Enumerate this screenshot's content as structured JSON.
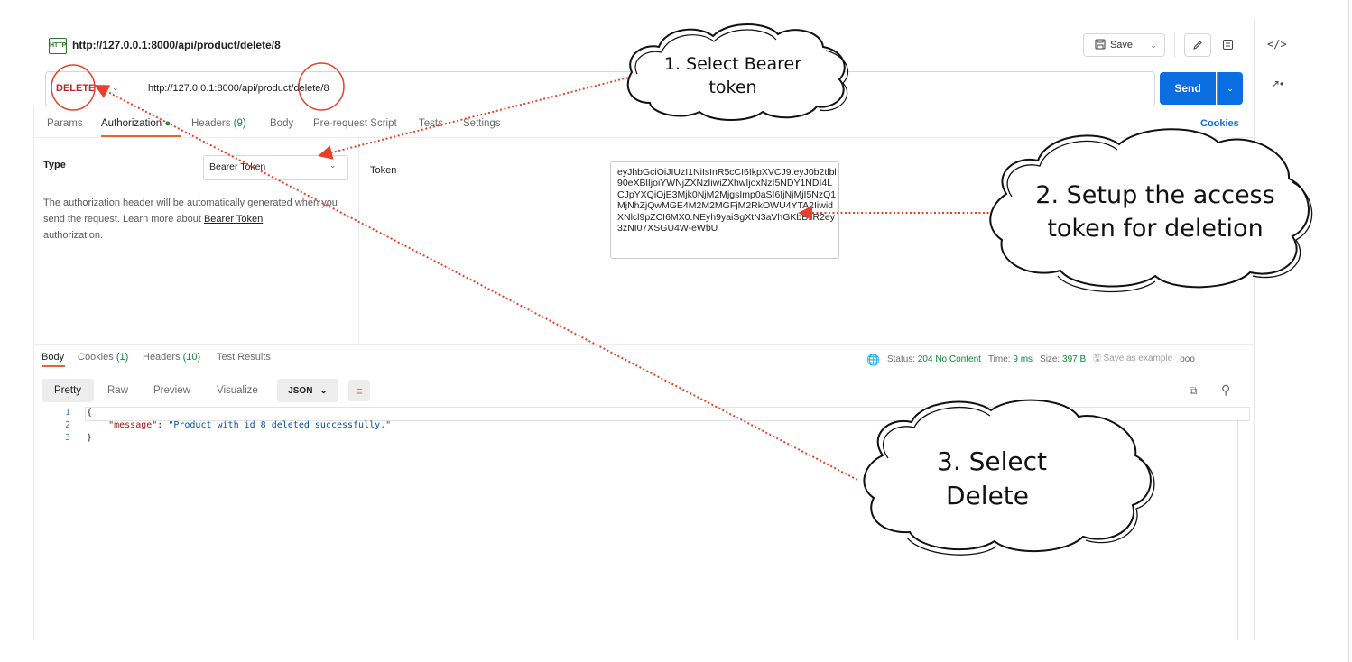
{
  "header": {
    "http_icon": "HTTP",
    "title": "http://127.0.0.1:8000/api/product/delete/8",
    "save_label": "Save",
    "icons": [
      "save-icon",
      "chevron-down-icon",
      "pencil-icon",
      "comment-icon",
      "code-icon",
      "sparkle-icon"
    ]
  },
  "request": {
    "method": "DELETE",
    "url": "http://127.0.0.1:8000/api/product/delete/8",
    "send_label": "Send",
    "tabs": [
      {
        "label": "Params"
      },
      {
        "label": "Authorization",
        "active": true
      },
      {
        "label": "Headers",
        "count": "(9)"
      },
      {
        "label": "Body"
      },
      {
        "label": "Pre-request Script"
      },
      {
        "label": "Tests"
      },
      {
        "label": "Settings"
      }
    ],
    "cookies_label": "Cookies"
  },
  "auth": {
    "type_label": "Type",
    "type_value": "Bearer Token",
    "desc_prefix": "The authorization header will be automatically generated when you send the request. Learn more about",
    "desc_link": "Bearer Token",
    "desc_suffix": "authorization.",
    "token_label": "Token",
    "token_value": "eyJhbGciOiJIUzI1NiIsInR5cCI6IkpXVCJ9.eyJ0b2tlbl90eXBlIjoiYWNjZXNzIiwiZXhwIjoxNzI5NDY1NDI4LCJpYXQiOjE3Mjk0NjM2MjgsImp0aSI6IjNjMjI5NzQ1MjNhZjQwMGE4M2M2MGFjM2RkOWU4YTA2IiwidXNlcl9pZCI6MX0.NEyh9yaiSgXtN3aVhGKbBsR2ey3zNI07XSGU4W-eWbU"
  },
  "response": {
    "tabs": [
      {
        "label": "Body",
        "active": true
      },
      {
        "label": "Cookies",
        "count": "(1)"
      },
      {
        "label": "Headers",
        "count": "(10)"
      },
      {
        "label": "Test Results"
      }
    ],
    "status_label": "Status:",
    "status_value": "204 No Content",
    "time_label": "Time:",
    "time_value": "9 ms",
    "size_label": "Size:",
    "size_value": "397 B",
    "save_example": "Save as example",
    "more": "ooo",
    "formats": [
      "Pretty",
      "Raw",
      "Preview",
      "Visualize"
    ],
    "format_select": "JSON",
    "code_lines": [
      {
        "n": "1",
        "text": "{"
      },
      {
        "n": "2",
        "key": "\"message\"",
        "sep": ": ",
        "value": "\"Product with id 8 deleted successfully.\""
      },
      {
        "n": "3",
        "text": "}"
      }
    ]
  },
  "annotations": {
    "cloud1_line1": "1.  Select Bearer",
    "cloud1_line2": "token",
    "cloud2_line1": "2. Setup the  access",
    "cloud2_line2": "token for deletion",
    "cloud3_line1": "3. Select",
    "cloud3_line2": "Delete",
    "arrow_color": "#e8402a"
  }
}
